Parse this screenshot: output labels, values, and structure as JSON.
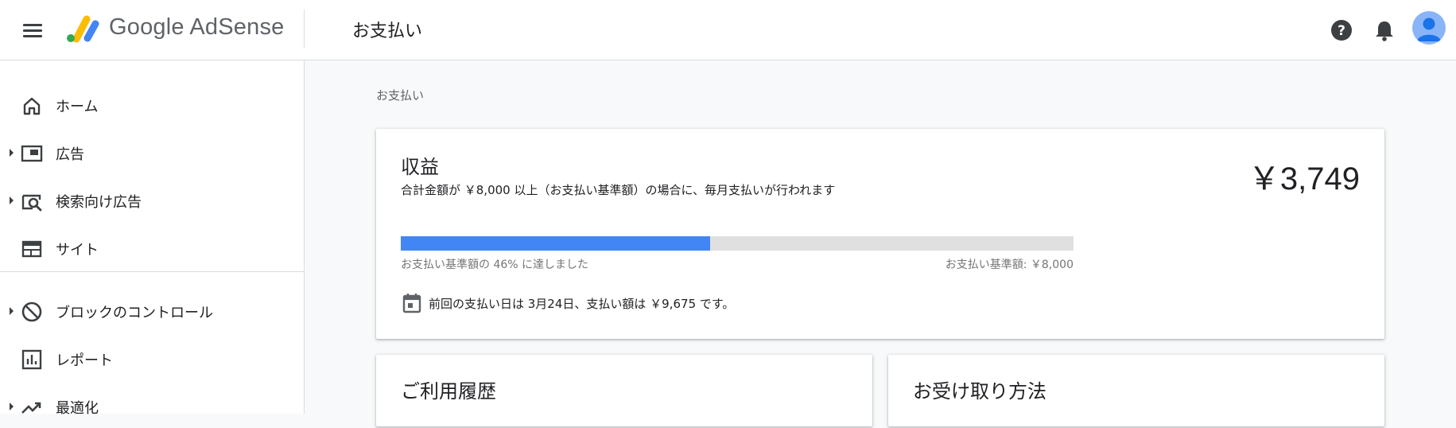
{
  "app": {
    "brand_name": "Google AdSense",
    "page_title": "お支払い"
  },
  "colors": {
    "accent": "#4285f4",
    "progress_track": "#e0e0e0",
    "logo_yellow": "#fbbc04",
    "logo_blue": "#4285f4",
    "logo_green": "#34a853"
  },
  "header": {
    "icons": [
      "menu-icon",
      "help-icon",
      "notifications-bell-icon",
      "account-avatar"
    ]
  },
  "sidebar": {
    "items": [
      {
        "label": "ホーム",
        "icon": "home-icon",
        "expandable": false
      },
      {
        "label": "広告",
        "icon": "ads-icon",
        "expandable": true
      },
      {
        "label": "検索向け広告",
        "icon": "search-ads-icon",
        "expandable": true
      },
      {
        "label": "サイト",
        "icon": "sites-icon",
        "expandable": false
      },
      {
        "label": "ブロックのコントロール",
        "icon": "block-icon",
        "expandable": true
      },
      {
        "label": "レポート",
        "icon": "reports-icon",
        "expandable": false
      },
      {
        "label": "最適化",
        "icon": "trending-up-icon",
        "expandable": true
      }
    ]
  },
  "main": {
    "breadcrumb": "お支払い",
    "earnings": {
      "title": "収益",
      "subtitle": "合計金額が ￥8,000 以上（お支払い基準額）の場合に、毎月支払いが行われます",
      "amount": "￥3,749",
      "progress_fraction": 0.46,
      "progress_label": "お支払い基準額の 46% に達しました",
      "threshold_label": "お支払い基準額: ￥8,000",
      "last_payment": "前回の支払い日は 3月24日、支払い額は ￥9,675 です。"
    },
    "history_card": {
      "title": "ご利用履歴"
    },
    "payment_method_card": {
      "title": "お受け取り方法"
    }
  }
}
